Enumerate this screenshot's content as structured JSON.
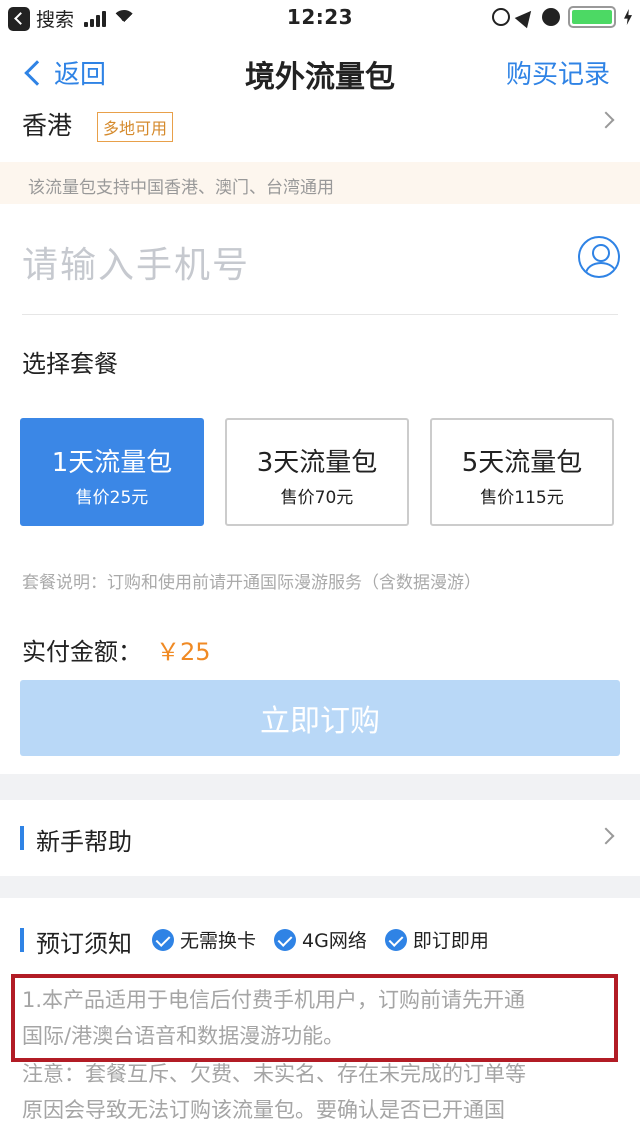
{
  "status_bar": {
    "back_app": "搜索",
    "time": "12:23"
  },
  "nav": {
    "back_label": "返回",
    "title": "境外流量包",
    "record_label": "购买记录"
  },
  "region": {
    "name": "香港",
    "tag": "多地可用"
  },
  "notice": "该流量包支持中国香港、澳门、台湾通用",
  "phone_input": {
    "placeholder": "请输入手机号",
    "value": ""
  },
  "package_section": {
    "title": "选择套餐"
  },
  "packages": [
    {
      "name": "1天流量包",
      "price": "售价25元",
      "selected": true
    },
    {
      "name": "3天流量包",
      "price": "售价70元",
      "selected": false
    },
    {
      "name": "5天流量包",
      "price": "售价115元",
      "selected": false
    }
  ],
  "package_desc": "套餐说明：订购和使用前请开通国际漫游服务（含数据漫游）",
  "payment": {
    "label": "实付金额：",
    "amount": "￥25"
  },
  "buy_button": "立即订购",
  "help": {
    "title": "新手帮助"
  },
  "rules": {
    "title": "预订须知",
    "badges": [
      "无需换卡",
      "4G网络",
      "即订即用"
    ],
    "para1_line1": "1.本产品适用于电信后付费手机用户，订购前请先开通",
    "para1_line2": "国际/港澳台语音和数据漫游功能。",
    "para2_line1": "注意：套餐互斥、欠费、未实名、存在未完成的订单等",
    "para2_line2": "原因会导致无法订购该流量包。要确认是否已开通国"
  },
  "colors": {
    "accent": "#2f83e5",
    "price": "#f08a24",
    "highlight_box": "#b21c25",
    "button_disabled": "#b9d8f7"
  }
}
